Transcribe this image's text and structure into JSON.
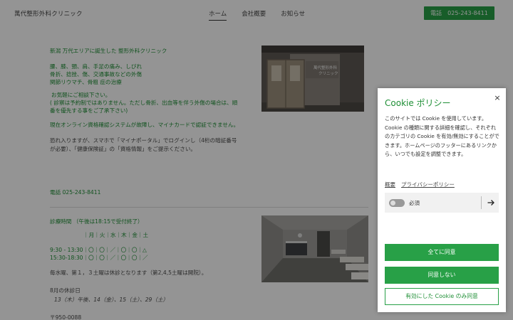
{
  "header": {
    "logo": "萬代整形外科クリニック",
    "nav": [
      "ホーム",
      "会社概要",
      "お知らせ"
    ],
    "phone_label": "電話",
    "phone_number": "025-243-8411"
  },
  "content": {
    "block1": [
      "新潟 万代エリアに誕生した 整形外科クリニック",
      "腰、膝、頸、肩、手足の痛み、しびれ",
      "骨折、捻挫、傷、交通事故などの外傷",
      "関節リウマチ、骨粗 症の治療",
      "お気軽にご相談下さい。",
      "( 診察は予約制ではありません。ただし骨折、出血等を伴う外傷の場合は、順",
      "番を優先する事をご了承下さい)",
      "現在オンライン資格確認システムが故障し、マイナカードで認証できません。"
    ],
    "block2": [
      "恐れ入りますが、スマホで「マイナポータル」でログインし（4桁の暗証番号",
      "が必要）、「健康保険証」の「資格情報」をご提示ください。"
    ],
    "phone_line": "電話 025-243-8411",
    "hours_title": "診療時間 （午後は18:15で受付終了）",
    "hours_header": "｜月｜火｜水｜木｜金｜土",
    "hours_am": "9:30 - 13:30｜〇｜〇｜／｜〇｜〇｜△",
    "hours_pm": "15:30-18:30｜〇｜〇｜／｜〇｜〇｜／",
    "closed_note": "毎水曜、第１，３土曜は休診となります（第2,4,5土曜は開院）。",
    "holiday_title": "8月の休診日",
    "holiday_dates": "13（木）午後、14（金）、15（土）、29（土）",
    "postal": "〒950-0088"
  },
  "photo1_sign": "萬代整形外科\nクリニック",
  "cookie": {
    "title": "Cookie ポリシー",
    "close": "×",
    "body": "このサイトでは Cookie を使用しています。Cookie の種類に関する詳細を確認し、それぞれのカテゴリの Cookie を有効/無効にすることができます。ホームページのフッターにあるリンクから、いつでも設定を調整できます。",
    "link_overview": "概要",
    "link_privacy": "プライバシーポリシー",
    "category_label": "必須",
    "btn_accept_all": "全てに同意",
    "btn_reject": "同意しない",
    "btn_accept_selected": "有効にした Cookie のみ同意"
  },
  "colors": {
    "accent_green": "#28a047",
    "text_green": "#1f8f36",
    "overlay": "rgba(0,0,0,0.42)"
  },
  "icons": {
    "close": "close-icon",
    "arrow": "arrow-right-icon"
  }
}
